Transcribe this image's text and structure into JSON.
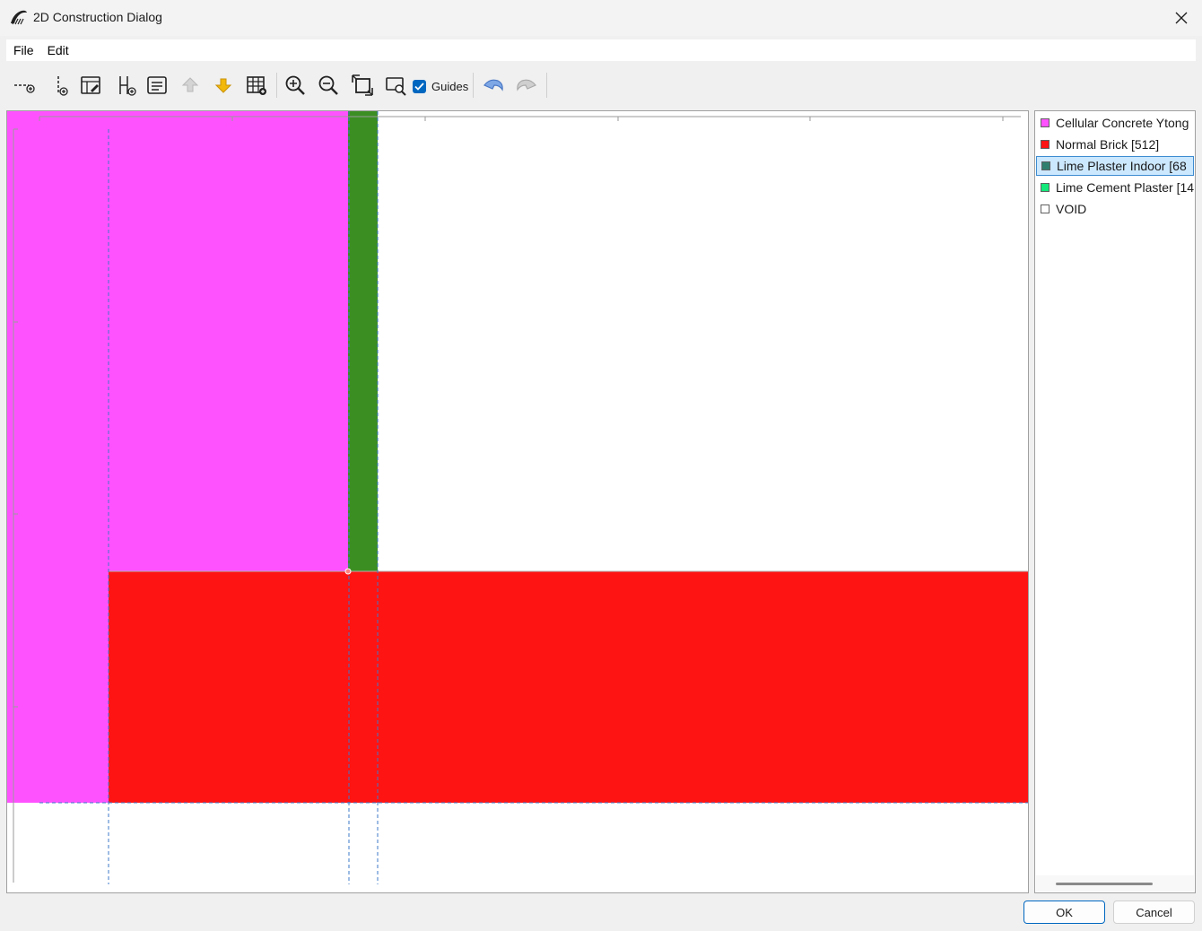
{
  "window": {
    "title": "2D Construction Dialog"
  },
  "menu": [
    {
      "label": "File"
    },
    {
      "label": "Edit"
    }
  ],
  "toolbar": {
    "guides_label": "Guides",
    "guides_checked": true
  },
  "legend": {
    "items": [
      {
        "label": "Cellular Concrete Ytong",
        "color": "#ff52ff",
        "selected": false
      },
      {
        "label": "Normal Brick [512]",
        "color": "#ff1414",
        "selected": false
      },
      {
        "label": "Lime Plaster Indoor [68",
        "color": "#2f7f6f",
        "selected": true
      },
      {
        "label": "Lime Cement Plaster [14",
        "color": "#14e87a",
        "selected": false
      },
      {
        "label": "VOID",
        "color": "#ffffff",
        "selected": false
      }
    ]
  },
  "colors": {
    "cellular_concrete": "#ff52ff",
    "normal_brick": "#ff1414",
    "plaster_strip": "#3b8e22",
    "guide_line": "#3c78c8",
    "accent": "#0067c0"
  },
  "buttons": {
    "ok": "OK",
    "cancel": "Cancel"
  }
}
